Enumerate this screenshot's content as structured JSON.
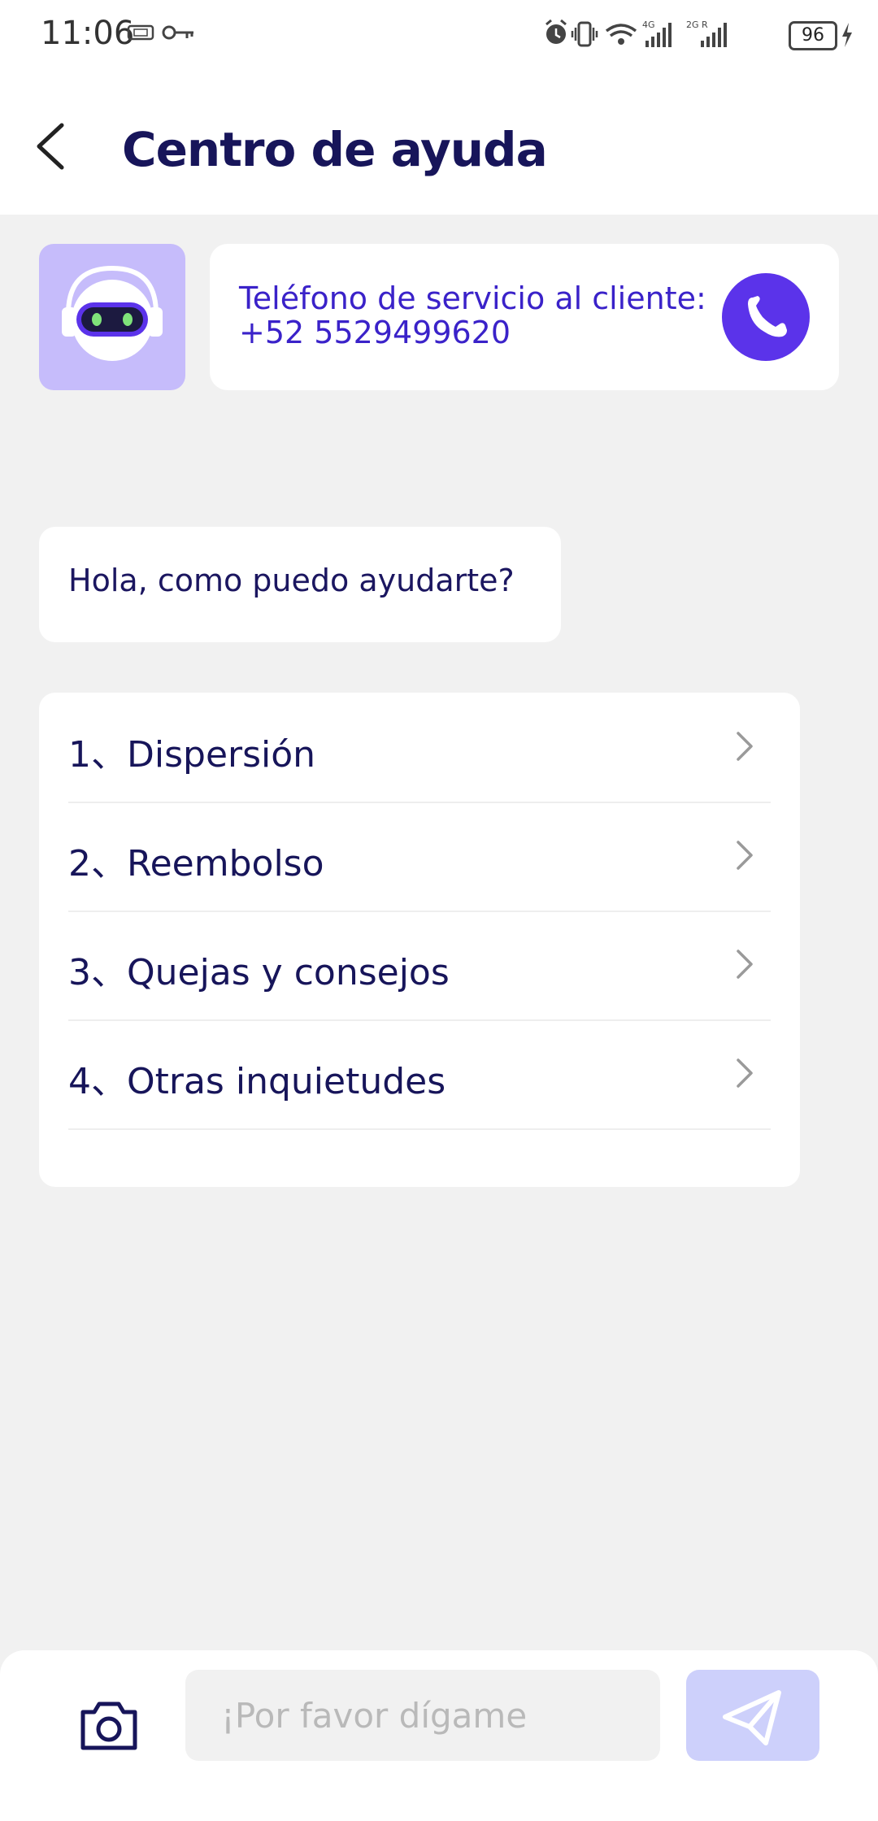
{
  "status_bar": {
    "time": "11:06",
    "battery": "96",
    "network_1": "4G",
    "network_2": "2G R"
  },
  "header": {
    "title": "Centro de ayuda",
    "back_icon": "chevron-left-icon"
  },
  "service": {
    "label": "Teléfono de servicio al cliente:",
    "phone": "+52 5529499620",
    "call_icon": "phone-icon",
    "accent_color": "#5b33ea"
  },
  "chat": {
    "greeting": "Hola, como puedo ayudarte?"
  },
  "options": [
    {
      "label": "1、Dispersión"
    },
    {
      "label": "2、Reembolso"
    },
    {
      "label": "3、Quejas y consejos"
    },
    {
      "label": "4、Otras inquietudes"
    }
  ],
  "composer": {
    "placeholder": "¡Por favor dígame",
    "value": "",
    "camera_icon": "camera-icon",
    "send_icon": "send-icon"
  }
}
